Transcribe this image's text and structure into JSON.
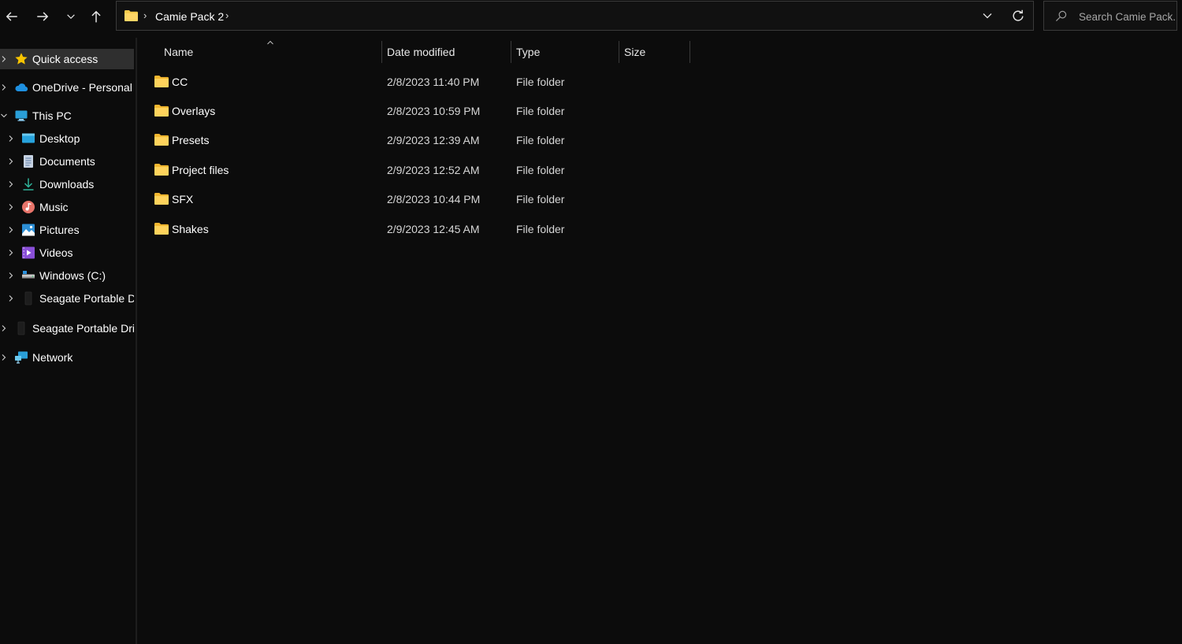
{
  "toolbar": {
    "back_icon": "arrow-left-icon",
    "forward_icon": "arrow-right-icon",
    "recent_icon": "chevron-down-icon",
    "up_icon": "arrow-up-icon"
  },
  "address": {
    "crumb": "Camie Pack 2",
    "separator": "›"
  },
  "search": {
    "placeholder": "Search Camie Pack..."
  },
  "sidebar": {
    "items": [
      {
        "label": "Quick access",
        "icon": "star-icon"
      },
      {
        "label": "OneDrive - Personal",
        "icon": "cloud-icon"
      },
      {
        "label": "This PC",
        "icon": "monitor-icon"
      },
      {
        "label": "Desktop",
        "icon": "desktop-icon"
      },
      {
        "label": "Documents",
        "icon": "document-icon"
      },
      {
        "label": "Downloads",
        "icon": "download-icon"
      },
      {
        "label": "Music",
        "icon": "music-icon"
      },
      {
        "label": "Pictures",
        "icon": "picture-icon"
      },
      {
        "label": "Videos",
        "icon": "video-icon"
      },
      {
        "label": "Windows (C:)",
        "icon": "drive-icon"
      },
      {
        "label": "Seagate Portable Drive",
        "icon": "external-drive-icon"
      },
      {
        "label": "Seagate Portable Drive",
        "icon": "external-drive-icon"
      },
      {
        "label": "Network",
        "icon": "network-icon"
      }
    ]
  },
  "columns": {
    "name": "Name",
    "date": "Date modified",
    "type": "Type",
    "size": "Size"
  },
  "files": [
    {
      "name": "CC",
      "date": "2/8/2023 11:40 PM",
      "type": "File folder"
    },
    {
      "name": "Overlays",
      "date": "2/8/2023 10:59 PM",
      "type": "File folder"
    },
    {
      "name": "Presets",
      "date": "2/9/2023 12:39 AM",
      "type": "File folder"
    },
    {
      "name": "Project files",
      "date": "2/9/2023 12:52 AM",
      "type": "File folder"
    },
    {
      "name": "SFX",
      "date": "2/8/2023 10:44 PM",
      "type": "File folder"
    },
    {
      "name": "Shakes",
      "date": "2/9/2023 12:45 AM",
      "type": "File folder"
    }
  ],
  "colors": {
    "background": "#0c0c0c",
    "folder": "#f8c94a",
    "selected": "#2f2f2f"
  }
}
